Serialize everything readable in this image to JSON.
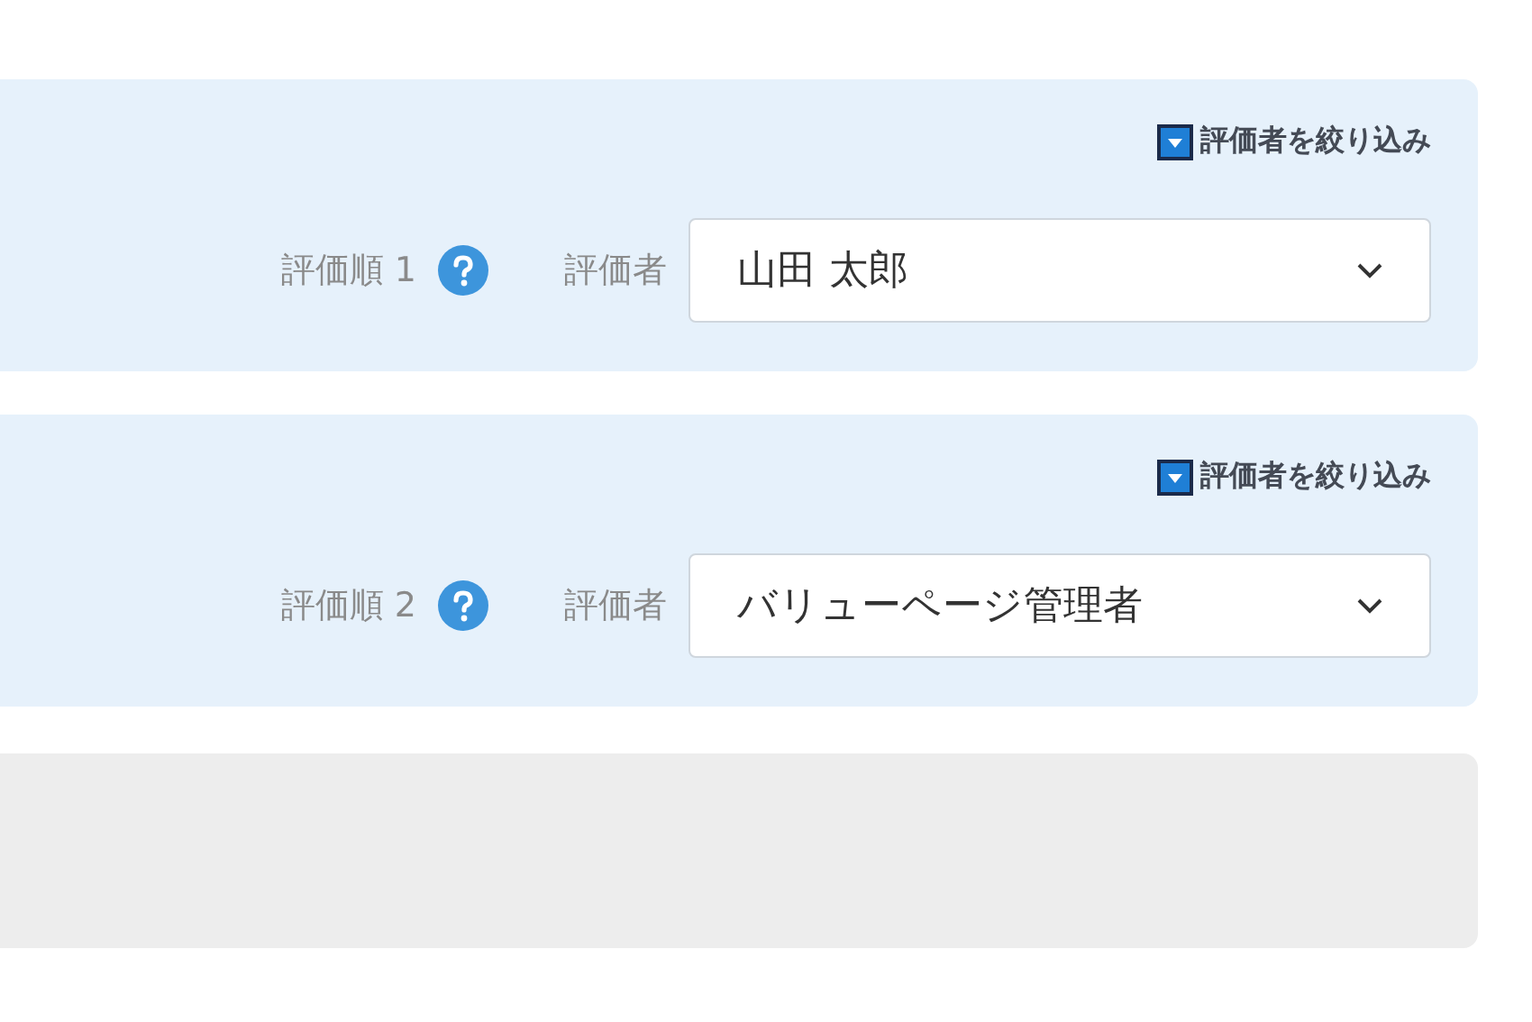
{
  "evaluators": [
    {
      "filter_link": "評価者を絞り込み",
      "order_label": "評価順 1",
      "evaluator_label": "評価者",
      "value": "山田 太郎"
    },
    {
      "filter_link": "評価者を絞り込み",
      "order_label": "評価順 2",
      "evaluator_label": "評価者",
      "value": "バリューページ管理者"
    }
  ]
}
